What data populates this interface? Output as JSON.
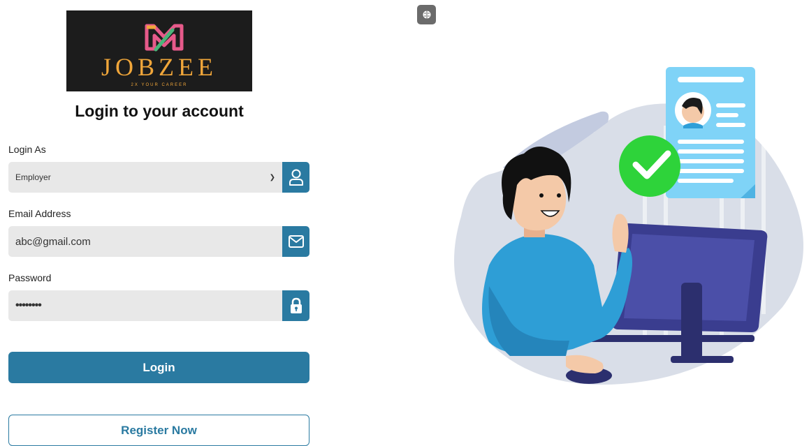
{
  "logo": {
    "brand": "JOBZEE",
    "tagline": "2X YOUR CAREER"
  },
  "form": {
    "title": "Login to your account",
    "role": {
      "label": "Login As",
      "value": "Employer",
      "icon": "user-icon"
    },
    "email": {
      "label": "Email Address",
      "value": "abc@gmail.com",
      "icon": "mail-icon"
    },
    "password": {
      "label": "Password",
      "value": "••••••••",
      "icon": "lock-icon"
    },
    "login_label": "Login",
    "register_label": "Register Now"
  },
  "toolbar": {
    "extension_icon": "brain-icon"
  },
  "colors": {
    "accent": "#2a7aa1",
    "field_bg": "#e8e8e8",
    "logo_bg": "#1c1c1c",
    "logo_text": "#f0a63a"
  }
}
